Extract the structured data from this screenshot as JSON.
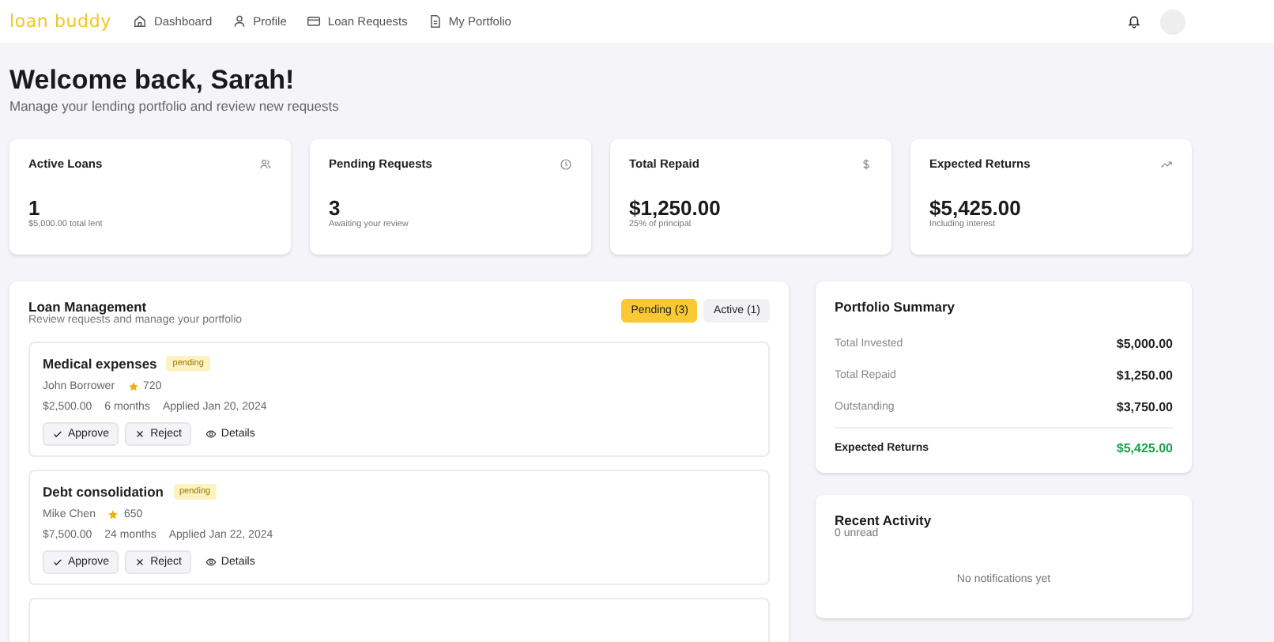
{
  "header": {
    "logo": "loan buddy",
    "nav": [
      {
        "label": "Dashboard"
      },
      {
        "label": "Profile"
      },
      {
        "label": "Loan Requests"
      },
      {
        "label": "My Portfolio"
      }
    ]
  },
  "welcome": {
    "title": "Welcome back, Sarah!",
    "subtitle": "Manage your lending portfolio and review new requests"
  },
  "stats": [
    {
      "label": "Active Loans",
      "value": "1",
      "note": "$5,000.00 total lent"
    },
    {
      "label": "Pending Requests",
      "value": "3",
      "note": "Awaiting your review"
    },
    {
      "label": "Total Repaid",
      "value": "$1,250.00",
      "note": "25% of principal"
    },
    {
      "label": "Expected Returns",
      "value": "$5,425.00",
      "note": "Including interest"
    }
  ],
  "loan_management": {
    "title": "Loan Management",
    "subtitle": "Review requests and manage your portfolio",
    "tabs": [
      {
        "label": "Pending (3)",
        "selected": true
      },
      {
        "label": "Active (1)",
        "selected": false
      }
    ],
    "loans": [
      {
        "purpose": "Medical expenses",
        "status": "pending",
        "borrower": "John Borrower",
        "score": "720",
        "amount": "$2,500.00",
        "term": "6 months",
        "applied": "Applied Jan 20, 2024",
        "actions": [
          "Approve",
          "Reject",
          "Details"
        ]
      },
      {
        "purpose": "Debt consolidation",
        "status": "pending",
        "borrower": "Mike Chen",
        "score": "650",
        "amount": "$7,500.00",
        "term": "24 months",
        "applied": "Applied Jan 22, 2024",
        "actions": [
          "Approve",
          "Reject",
          "Details"
        ]
      }
    ]
  },
  "portfolio_summary": {
    "title": "Portfolio Summary",
    "rows": [
      {
        "label": "Total Invested",
        "value": "$5,000.00",
        "emphasis": false
      },
      {
        "label": "Total Repaid",
        "value": "$1,250.00",
        "emphasis": false
      },
      {
        "label": "Outstanding",
        "value": "$3,750.00",
        "emphasis": false
      },
      {
        "label": "Expected Returns",
        "value": "$5,425.00",
        "emphasis": true
      }
    ]
  },
  "recent_activity": {
    "title": "Recent Activity",
    "unread": "0 unread",
    "empty": "No notifications yet"
  }
}
